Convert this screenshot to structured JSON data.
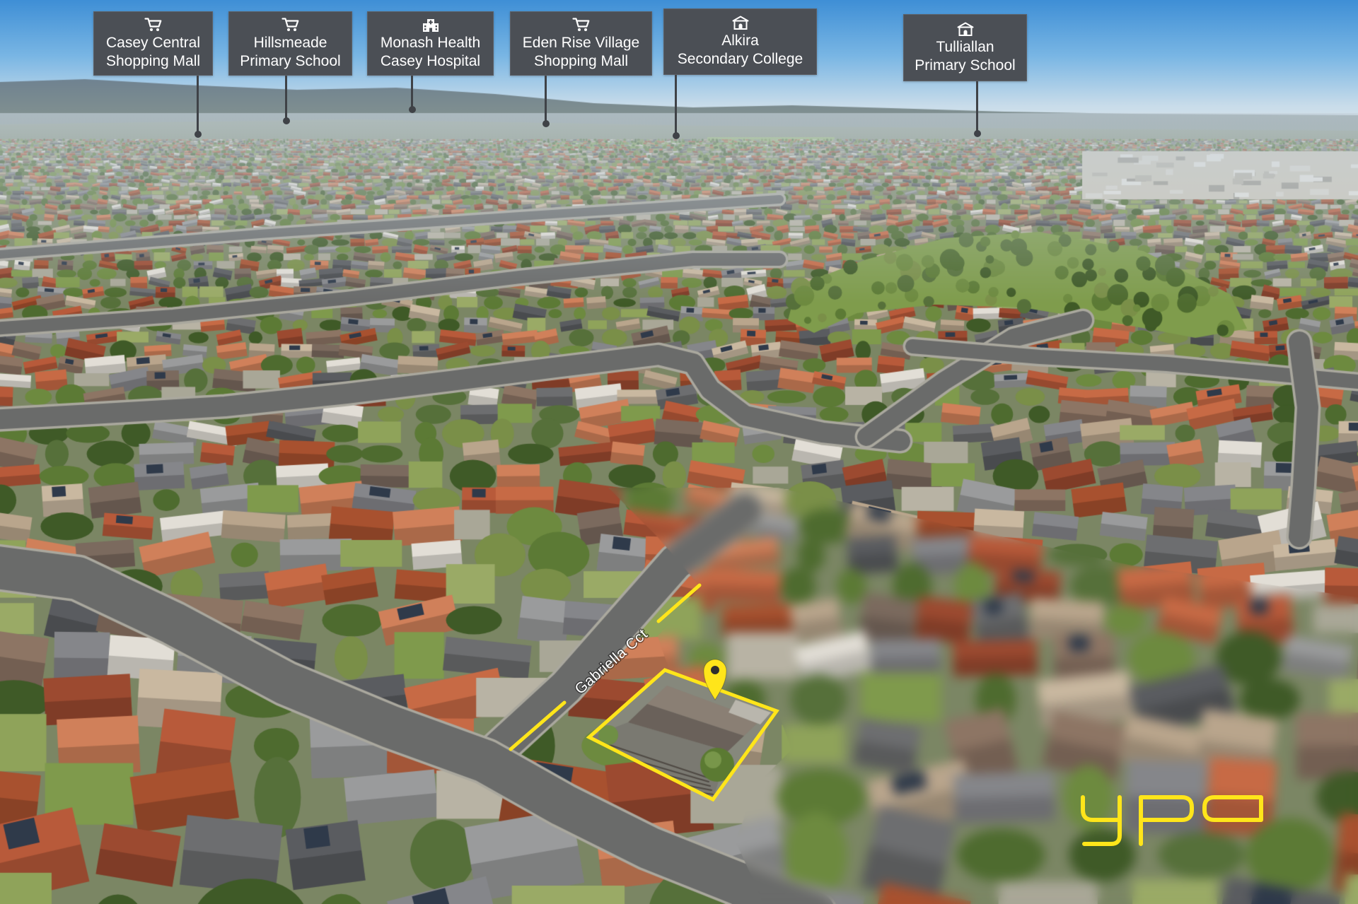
{
  "pois": [
    {
      "icon": "shopping-cart-icon",
      "line1": "Casey Central",
      "line2": "Shopping Mall"
    },
    {
      "icon": "shopping-cart-icon",
      "line1": "Hillsmeade",
      "line2": "Primary School"
    },
    {
      "icon": "hospital-icon",
      "line1": "Monash Health",
      "line2": "Casey Hospital"
    },
    {
      "icon": "shopping-cart-icon",
      "line1": "Eden Rise Village",
      "line2": "Shopping Mall"
    },
    {
      "icon": "school-icon",
      "line1": "Alkira",
      "line2": "Secondary College"
    },
    {
      "icon": "school-icon",
      "line1": "Tulliallan",
      "line2": "Primary School"
    }
  ],
  "street": {
    "name": "Gabriella Cct"
  },
  "property": {
    "marker_icon": "location-pin-icon"
  },
  "logo": {
    "text": "ypa"
  },
  "colors": {
    "accent": "#FFE51A",
    "label_bg": "#4B4F55",
    "label_text": "#FFFFFF"
  }
}
